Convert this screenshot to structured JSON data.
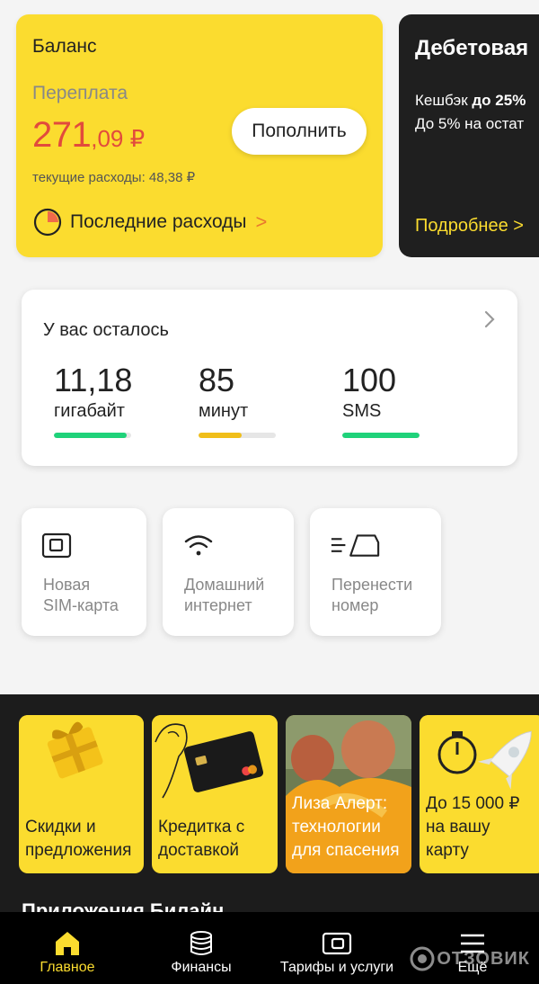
{
  "balance": {
    "title": "Баланс",
    "overpay_label": "Переплата",
    "amount_main": "271",
    "amount_fraction": ",09 ₽",
    "current_spend": "текущие расходы: 48,38 ₽",
    "topup_label": "Пополнить",
    "last_spend_label": "Последние расходы",
    "chevron": ">"
  },
  "debit": {
    "title": "Дебетовая",
    "cashback_prefix": "Кешбэк ",
    "cashback_bold": "до 25%",
    "line2": "До 5% на остат",
    "more_label": "Подробнее >"
  },
  "remaining": {
    "title": "У вас осталось",
    "stats": [
      {
        "value": "11,18",
        "unit": "гигабайт",
        "fill": 0.94,
        "color": "#1fd27a"
      },
      {
        "value": "85",
        "unit": "минут",
        "fill": 0.56,
        "color": "#f0be19"
      },
      {
        "value": "100",
        "unit": "SMS",
        "fill": 1.0,
        "color": "#1fd27a"
      }
    ]
  },
  "tiles": [
    {
      "label": "Новая\nSIM-карта",
      "icon": "sim-card-icon"
    },
    {
      "label": "Домашний\nинтернет",
      "icon": "wifi-icon"
    },
    {
      "label": "Перенести\nномер",
      "icon": "transfer-number-icon"
    }
  ],
  "promos": [
    {
      "label": "Скидки и\nпредложения",
      "icon": "gift-icon"
    },
    {
      "label": "Кредитка с\nдоставкой",
      "icon": "credit-card-icon"
    },
    {
      "label": "Лиза Алерт:\nтехнологии\nдля спасения",
      "icon": "people-photo"
    },
    {
      "label": "До 15 000 ₽\nна вашу\nкарту",
      "icon": "rocket-icon"
    }
  ],
  "apps_title": "Приложения Билайн",
  "nav": [
    {
      "label": "Главное",
      "icon": "home-icon",
      "active": true
    },
    {
      "label": "Финансы",
      "icon": "coins-icon",
      "active": false
    },
    {
      "label": "Тарифы и услуги",
      "icon": "sim-icon",
      "active": false
    },
    {
      "label": "Ещё",
      "icon": "menu-icon",
      "active": false
    }
  ],
  "watermark": "ОТЗОВИК",
  "colors": {
    "brand_yellow": "#fbdc2f",
    "amount_red": "#e24b3c",
    "accent_orange": "#e9782d",
    "green": "#1fd27a",
    "dark": "#1c1c1c"
  }
}
